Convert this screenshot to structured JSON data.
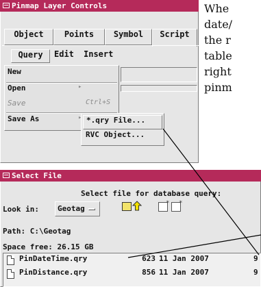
{
  "pinmap_window": {
    "title": "Pinmap Layer Controls",
    "tabs": [
      "Object",
      "Points",
      "Symbol",
      "Script"
    ],
    "menubar": [
      "Query",
      "Edit",
      "Insert"
    ],
    "menu_items": [
      {
        "label": "New",
        "shortcut": "",
        "submenu": false,
        "enabled": true
      },
      {
        "label": "Open",
        "shortcut": "",
        "submenu": true,
        "enabled": true
      },
      {
        "label": "Save",
        "shortcut": "Ctrl+S",
        "submenu": false,
        "enabled": false
      },
      {
        "label": "Save As",
        "shortcut": "",
        "submenu": true,
        "enabled": true
      }
    ],
    "submenu_items": [
      "*.qry File...",
      "RVC Object..."
    ]
  },
  "description_lines": [
    "Whe",
    "date/",
    "the r",
    "table",
    "right",
    "pinm"
  ],
  "select_file_window": {
    "title": "Select File",
    "prompt": "Select file for database query:",
    "look_in_label": "Look in:",
    "look_in_value": "Geotag",
    "path_label": "Path:",
    "path_value": "C:\\Geotag",
    "space_free_label": "Space free:",
    "space_free_value": "26.15 GB",
    "files": [
      {
        "name": "PinDateTime.qry",
        "size": "623",
        "date": "11 Jan 2007",
        "extra": "9"
      },
      {
        "name": "PinDistance.qry",
        "size": "856",
        "date": "11 Jan 2007",
        "extra": "9"
      }
    ]
  },
  "colors": {
    "titlebar": "#b52a5a",
    "panel": "#e6e6e6",
    "callout_line": "#000000"
  }
}
